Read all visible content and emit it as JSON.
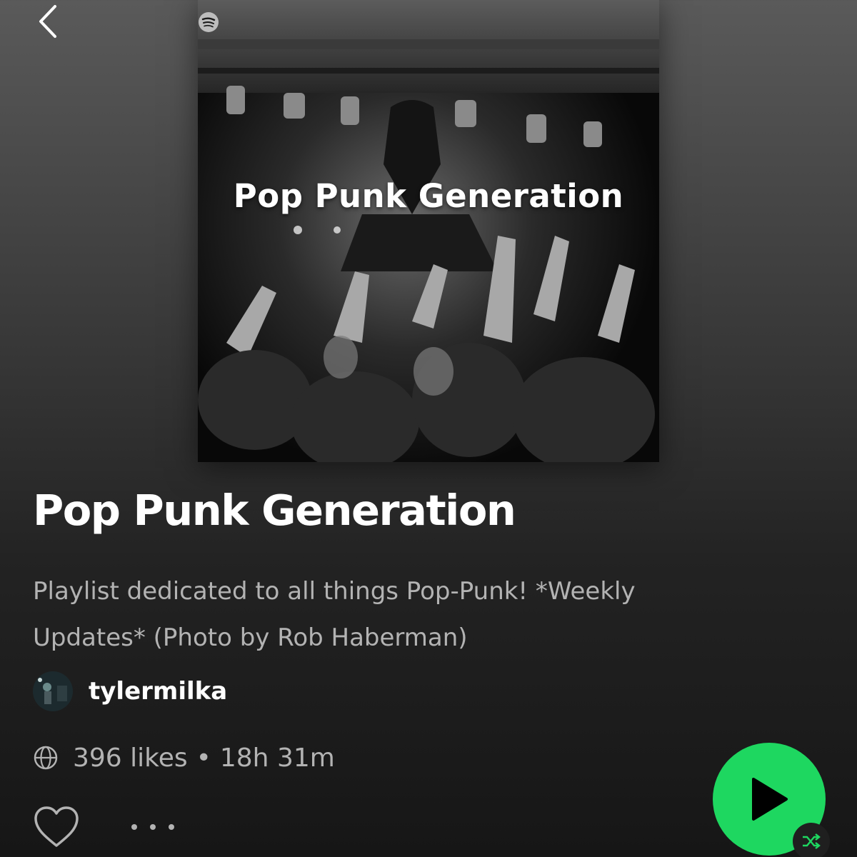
{
  "header": {
    "back_icon": "chevron-left-icon"
  },
  "cover": {
    "text": "Pop Punk Generation",
    "logo_icon": "spotify-logo-icon"
  },
  "playlist": {
    "title": "Pop Punk Generation",
    "description": "Playlist dedicated to all things Pop-Punk! *Weekly Updates* (Photo by Rob Haberman)",
    "owner": "tylermilka",
    "likes": "396 likes",
    "separator": "•",
    "duration": "18h 31m",
    "visibility_icon": "globe-icon"
  },
  "actions": {
    "like_icon": "heart-outline-icon",
    "more_icon": "more-options-icon",
    "play_icon": "play-icon",
    "shuffle_icon": "shuffle-icon"
  },
  "colors": {
    "accent": "#1ed760",
    "text_primary": "#ffffff",
    "text_secondary": "#b3b3b3"
  }
}
